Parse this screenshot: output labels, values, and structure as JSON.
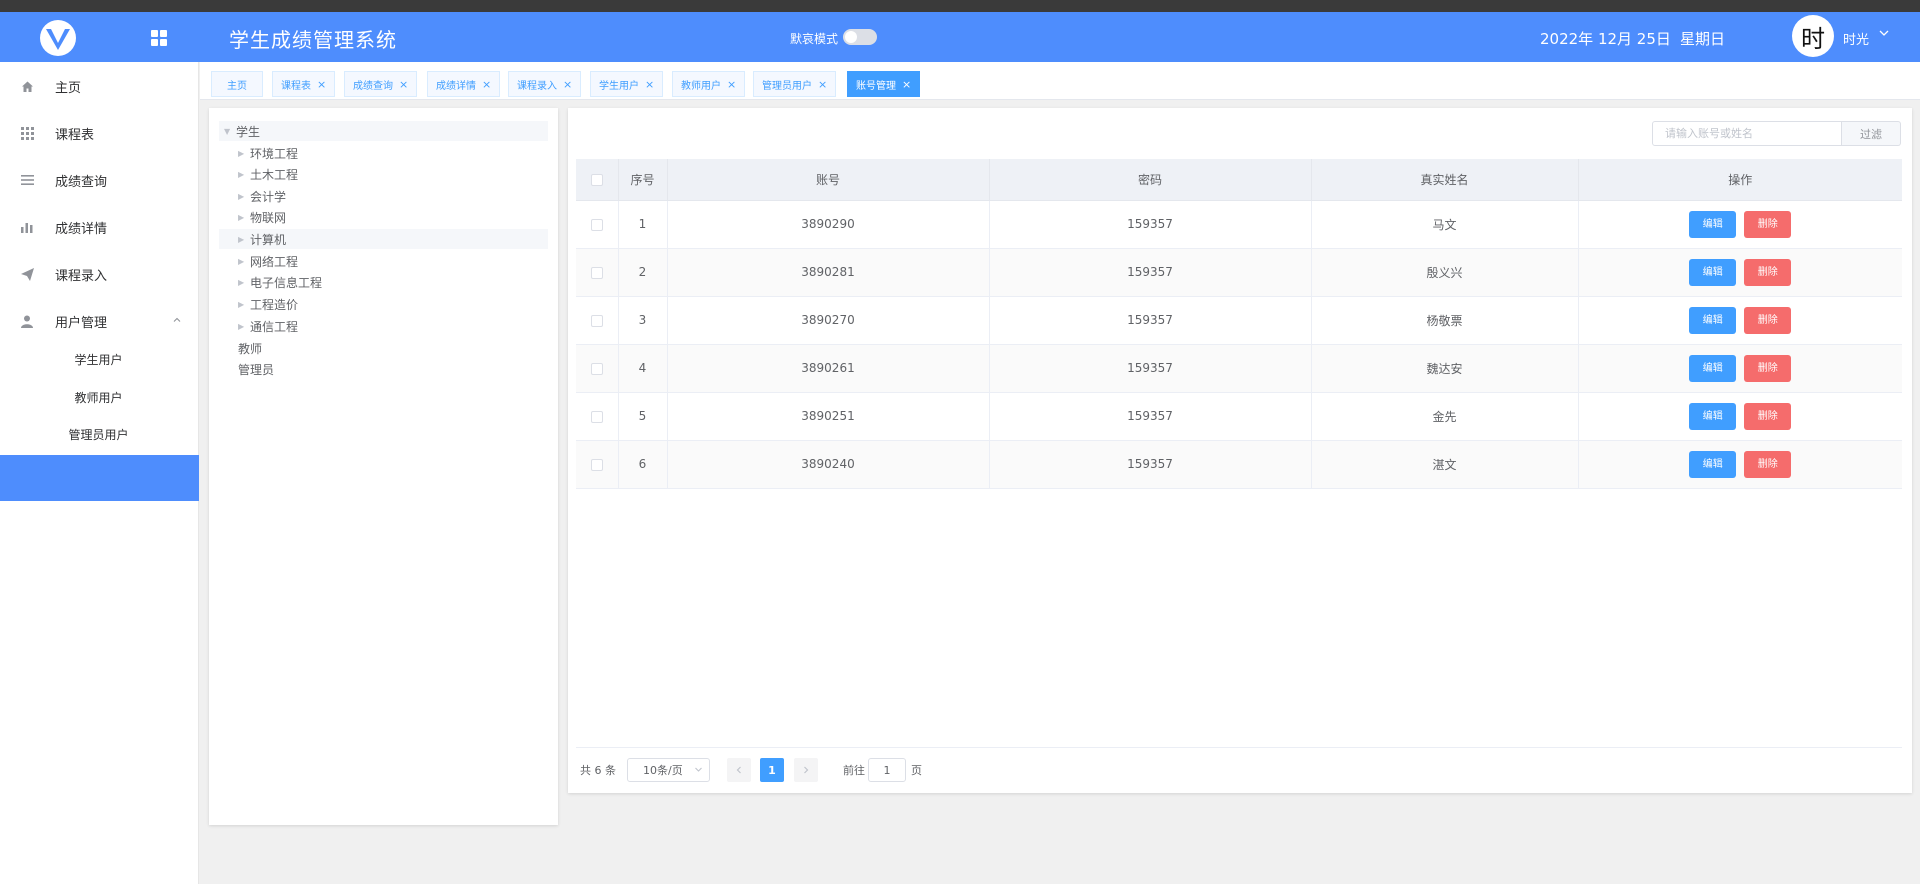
{
  "header": {
    "title": "学生成绩管理系统",
    "mode_label": "默哀模式",
    "date": "2022年 12月 25日",
    "weekday": "星期日",
    "avatar_char": "时",
    "username": "时光"
  },
  "sidebar": {
    "items": [
      {
        "label": "主页",
        "icon": "home-icon"
      },
      {
        "label": "课程表",
        "icon": "apps-grid-icon"
      },
      {
        "label": "成绩查询",
        "icon": "list-icon"
      },
      {
        "label": "成绩详情",
        "icon": "bar-chart-icon"
      },
      {
        "label": "课程录入",
        "icon": "send-icon"
      },
      {
        "label": "用户管理",
        "icon": "user-icon"
      }
    ],
    "sub_items": [
      "学生用户",
      "教师用户",
      "管理员用户"
    ]
  },
  "tags": [
    {
      "label": "主页",
      "closable": false,
      "active": false
    },
    {
      "label": "课程表",
      "closable": true,
      "active": false
    },
    {
      "label": "成绩查询",
      "closable": true,
      "active": false
    },
    {
      "label": "成绩详情",
      "closable": true,
      "active": false
    },
    {
      "label": "课程录入",
      "closable": true,
      "active": false
    },
    {
      "label": "学生用户",
      "closable": true,
      "active": false
    },
    {
      "label": "教师用户",
      "closable": true,
      "active": false
    },
    {
      "label": "管理员用户",
      "closable": true,
      "active": false
    },
    {
      "label": "账号管理",
      "closable": true,
      "active": true
    }
  ],
  "tree": {
    "root": "学生",
    "children": [
      "环境工程",
      "土木工程",
      "会计学",
      "物联网",
      "计算机",
      "网络工程",
      "电子信息工程",
      "工程造价",
      "通信工程"
    ],
    "others": [
      "教师",
      "管理员"
    ]
  },
  "search": {
    "placeholder": "请输入账号或姓名",
    "button": "过滤"
  },
  "table": {
    "headers": [
      "序号",
      "账号",
      "密码",
      "真实姓名",
      "操作"
    ],
    "rows": [
      {
        "index": "1",
        "account": "3890290",
        "password": "159357",
        "name": "马文"
      },
      {
        "index": "2",
        "account": "3890281",
        "password": "159357",
        "name": "殷义兴"
      },
      {
        "index": "3",
        "account": "3890270",
        "password": "159357",
        "name": "杨敬票"
      },
      {
        "index": "4",
        "account": "3890261",
        "password": "159357",
        "name": "魏达安"
      },
      {
        "index": "5",
        "account": "3890251",
        "password": "159357",
        "name": "金先"
      },
      {
        "index": "6",
        "account": "3890240",
        "password": "159357",
        "name": "湛文"
      }
    ],
    "edit_label": "编辑",
    "delete_label": "删除"
  },
  "pagination": {
    "total": "共 6 条",
    "page_size": "10条/页",
    "current_page": "1",
    "goto_label": "前往",
    "goto_value": "1",
    "page_suffix": "页"
  },
  "colors": {
    "header_bg": "#4e8dfd",
    "primary": "#409eff",
    "danger": "#f56c6c"
  }
}
